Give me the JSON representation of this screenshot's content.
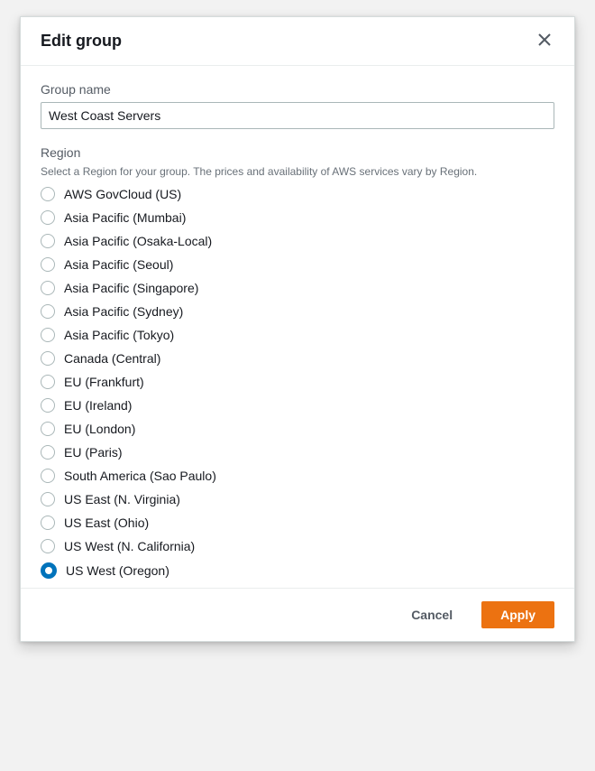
{
  "modal": {
    "title": "Edit group",
    "groupName": {
      "label": "Group name",
      "value": "West Coast Servers"
    },
    "region": {
      "label": "Region",
      "helper": "Select a Region for your group. The prices and availability of AWS services vary by Region.",
      "selected": "US West (Oregon)",
      "options": [
        "AWS GovCloud (US)",
        "Asia Pacific (Mumbai)",
        "Asia Pacific (Osaka-Local)",
        "Asia Pacific (Seoul)",
        "Asia Pacific (Singapore)",
        "Asia Pacific (Sydney)",
        "Asia Pacific (Tokyo)",
        "Canada (Central)",
        "EU (Frankfurt)",
        "EU (Ireland)",
        "EU (London)",
        "EU (Paris)",
        "South America (Sao Paulo)",
        "US East (N. Virginia)",
        "US East (Ohio)",
        "US West (N. California)",
        "US West (Oregon)"
      ]
    },
    "footer": {
      "cancel": "Cancel",
      "apply": "Apply"
    }
  }
}
